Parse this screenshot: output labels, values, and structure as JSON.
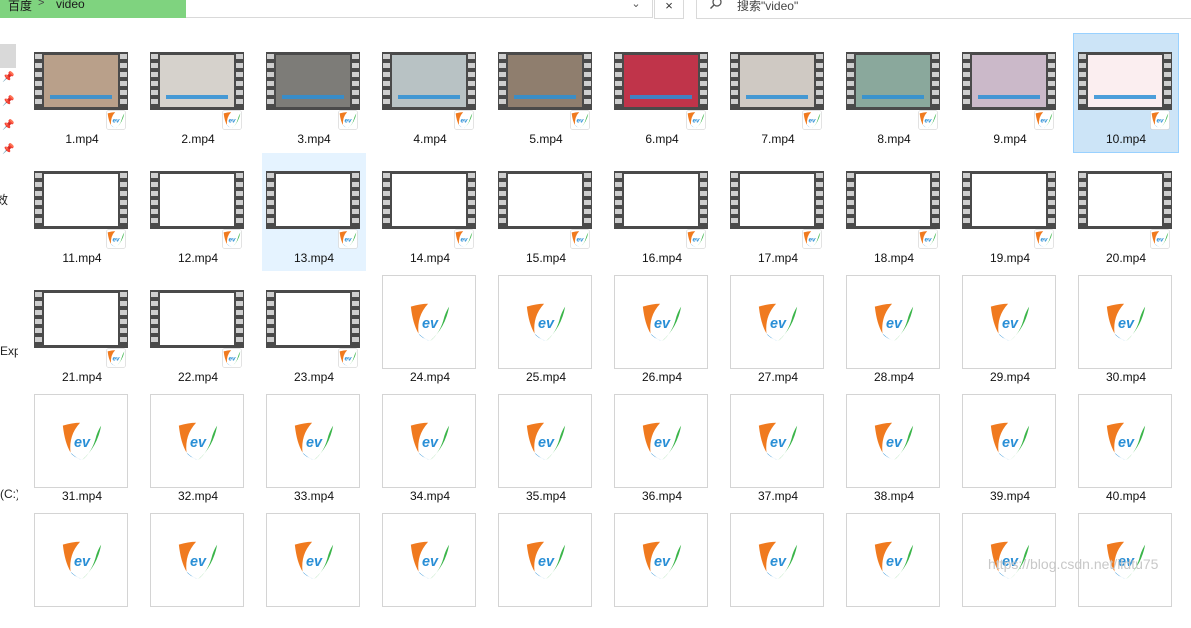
{
  "address": {
    "crumb_root": "百度",
    "crumb_sep": ">",
    "crumb_current": "video",
    "close_label": "×"
  },
  "search": {
    "placeholder": "搜索\"video\""
  },
  "nav": {
    "labels": [
      "效",
      "Exp",
      "(C:)"
    ]
  },
  "files": [
    {
      "name": "1.mp4",
      "thumb": "video",
      "scene": "#b9a08a"
    },
    {
      "name": "2.mp4",
      "thumb": "video",
      "scene": "#d6d2cc"
    },
    {
      "name": "3.mp4",
      "thumb": "video",
      "scene": "#7d7c78"
    },
    {
      "name": "4.mp4",
      "thumb": "video",
      "scene": "#b8c2c4"
    },
    {
      "name": "5.mp4",
      "thumb": "video",
      "scene": "#8f7e6e"
    },
    {
      "name": "6.mp4",
      "thumb": "video",
      "scene": "#c0344a"
    },
    {
      "name": "7.mp4",
      "thumb": "video",
      "scene": "#cfc9c3"
    },
    {
      "name": "8.mp4",
      "thumb": "video",
      "scene": "#8aa89c"
    },
    {
      "name": "9.mp4",
      "thumb": "video",
      "scene": "#cbb9c9"
    },
    {
      "name": "10.mp4",
      "thumb": "video",
      "scene": "#fbeef0",
      "state": "selected"
    },
    {
      "name": "11.mp4",
      "thumb": "blank"
    },
    {
      "name": "12.mp4",
      "thumb": "blank"
    },
    {
      "name": "13.mp4",
      "thumb": "blank",
      "state": "hover"
    },
    {
      "name": "14.mp4",
      "thumb": "blank"
    },
    {
      "name": "15.mp4",
      "thumb": "blank"
    },
    {
      "name": "16.mp4",
      "thumb": "blank"
    },
    {
      "name": "17.mp4",
      "thumb": "blank"
    },
    {
      "name": "18.mp4",
      "thumb": "blank"
    },
    {
      "name": "19.mp4",
      "thumb": "blank"
    },
    {
      "name": "20.mp4",
      "thumb": "blank"
    },
    {
      "name": "21.mp4",
      "thumb": "blank"
    },
    {
      "name": "22.mp4",
      "thumb": "blank"
    },
    {
      "name": "23.mp4",
      "thumb": "blank"
    },
    {
      "name": "24.mp4",
      "thumb": "app"
    },
    {
      "name": "25.mp4",
      "thumb": "app"
    },
    {
      "name": "26.mp4",
      "thumb": "app"
    },
    {
      "name": "27.mp4",
      "thumb": "app"
    },
    {
      "name": "28.mp4",
      "thumb": "app"
    },
    {
      "name": "29.mp4",
      "thumb": "app"
    },
    {
      "name": "30.mp4",
      "thumb": "app"
    },
    {
      "name": "31.mp4",
      "thumb": "app"
    },
    {
      "name": "32.mp4",
      "thumb": "app"
    },
    {
      "name": "33.mp4",
      "thumb": "app"
    },
    {
      "name": "34.mp4",
      "thumb": "app"
    },
    {
      "name": "35.mp4",
      "thumb": "app"
    },
    {
      "name": "36.mp4",
      "thumb": "app"
    },
    {
      "name": "37.mp4",
      "thumb": "app"
    },
    {
      "name": "38.mp4",
      "thumb": "app"
    },
    {
      "name": "39.mp4",
      "thumb": "app"
    },
    {
      "name": "40.mp4",
      "thumb": "app"
    },
    {
      "name": "",
      "thumb": "app"
    },
    {
      "name": "",
      "thumb": "app"
    },
    {
      "name": "",
      "thumb": "app"
    },
    {
      "name": "",
      "thumb": "app"
    },
    {
      "name": "",
      "thumb": "app"
    },
    {
      "name": "",
      "thumb": "app"
    },
    {
      "name": "",
      "thumb": "app"
    },
    {
      "name": "",
      "thumb": "app"
    },
    {
      "name": "",
      "thumb": "app"
    },
    {
      "name": "",
      "thumb": "app"
    }
  ],
  "icons": {
    "app_icon": "ev-player-icon",
    "badge_icon": "ev-badge-icon",
    "search_icon": "search-icon"
  },
  "colors": {
    "ev_orange": "#f07a1f",
    "ev_blue": "#2a8fd6",
    "ev_green": "#3bb54a",
    "selection": "#cce4f7",
    "crumb_bg": "#7fd37f"
  },
  "watermark": "https://blog.csdn.net/ildtu75"
}
